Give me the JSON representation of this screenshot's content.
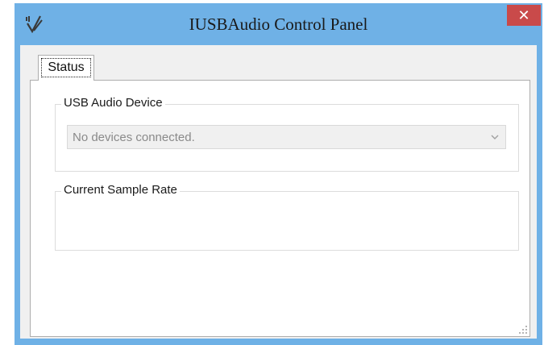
{
  "window": {
    "title": "IUSBAudio Control Panel",
    "close_symbol": "✕",
    "app_icon": "wave-logo-icon",
    "close_color": "#c94a4a",
    "frame_color": "#6fb1e6"
  },
  "tabs": [
    {
      "label": "Status",
      "selected": true
    }
  ],
  "groups": {
    "device": {
      "label": "USB Audio Device",
      "dropdown": {
        "value": "No devices connected.",
        "icon": "chevron-down-icon"
      }
    },
    "sample_rate": {
      "label": "Current Sample Rate"
    }
  }
}
